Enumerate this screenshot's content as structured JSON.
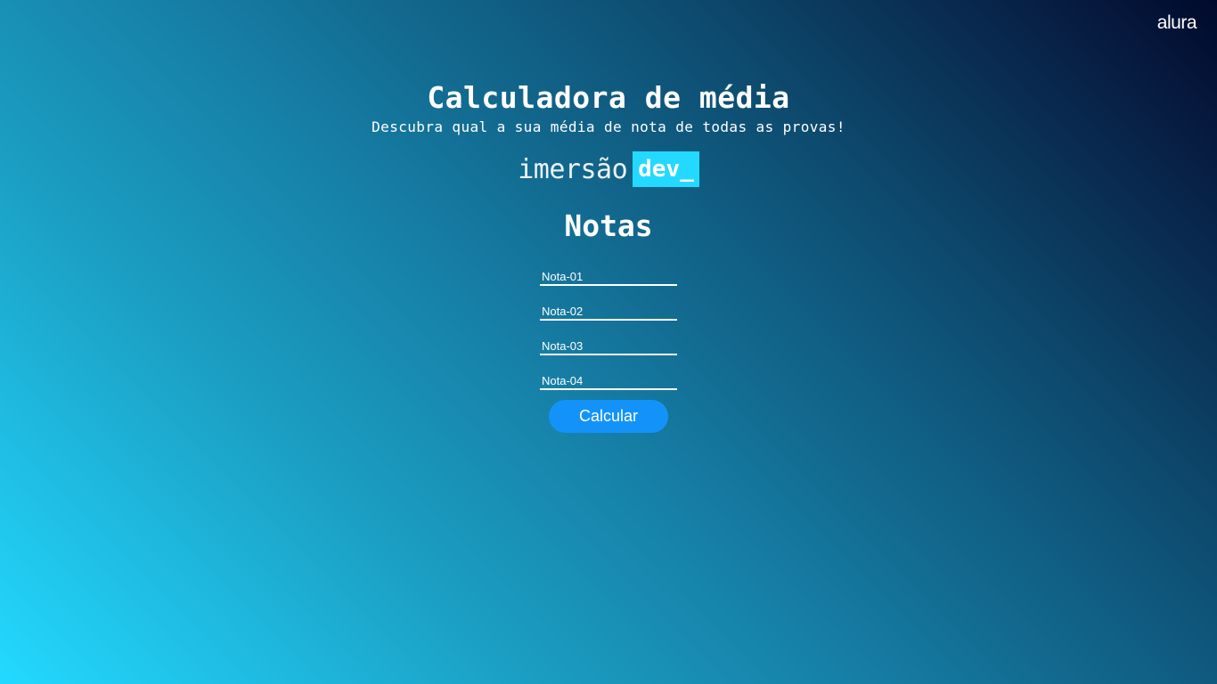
{
  "header": {
    "brand": "alura"
  },
  "main": {
    "title": "Calculadora de média",
    "subtitle": "Descubra qual a sua média de nota de todas as provas!",
    "badge": {
      "word": "imersão",
      "highlight": "dev_"
    },
    "section_title": "Notas",
    "fields": [
      {
        "placeholder": "Nota-01",
        "value": ""
      },
      {
        "placeholder": "Nota-02",
        "value": ""
      },
      {
        "placeholder": "Nota-03",
        "value": ""
      },
      {
        "placeholder": "Nota-04",
        "value": ""
      }
    ],
    "button_label": "Calcular"
  },
  "colors": {
    "gradient_light": "#23d9ff",
    "gradient_dark": "#000a2c",
    "button": "#1393fa",
    "highlight": "#23d9ff"
  }
}
